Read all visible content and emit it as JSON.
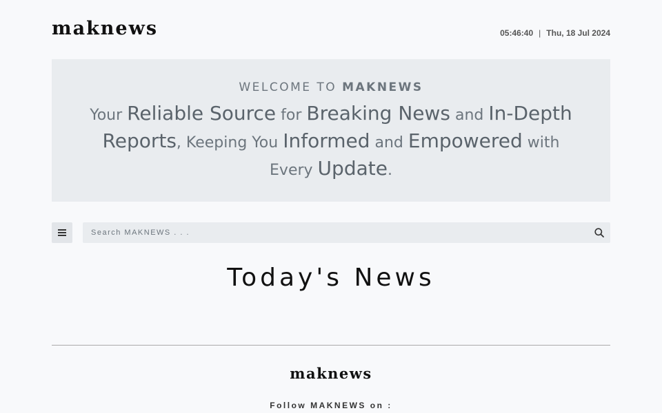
{
  "header": {
    "logo": "maknews",
    "time": "05:46:40",
    "separator": "|",
    "date": "Thu, 18 Jul 2024"
  },
  "hero": {
    "kicker_prefix": "WELCOME TO ",
    "kicker_brand": "MAKNEWS",
    "tagline": [
      {
        "text": "Your ",
        "em": false
      },
      {
        "text": "Reliable Source",
        "em": true
      },
      {
        "text": " for ",
        "em": false
      },
      {
        "text": "Breaking News",
        "em": true
      },
      {
        "text": " and ",
        "em": false
      },
      {
        "text": "In-Depth Reports",
        "em": true
      },
      {
        "text": ", Keeping You ",
        "em": false
      },
      {
        "text": "Informed",
        "em": true
      },
      {
        "text": " and ",
        "em": false
      },
      {
        "text": "Empowered",
        "em": true
      },
      {
        "text": " with Every ",
        "em": false
      },
      {
        "text": "Update",
        "em": true
      },
      {
        "text": ".",
        "em": false
      }
    ]
  },
  "toolbar": {
    "menu_icon": "hamburger-icon",
    "search_placeholder": "Search MAKNEWS . . .",
    "search_value": "",
    "search_icon": "search-icon"
  },
  "main": {
    "section_title": "Today's News"
  },
  "footer": {
    "logo": "maknews",
    "follow_text": "Follow MAKNEWS on :"
  }
}
